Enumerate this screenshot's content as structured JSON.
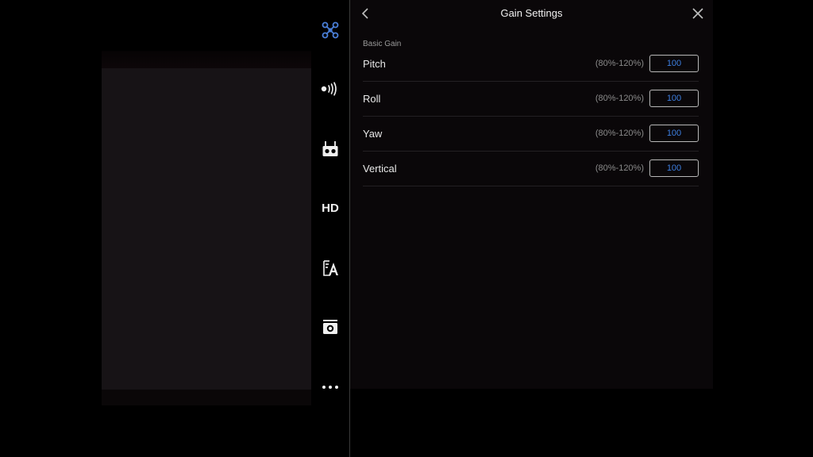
{
  "panel": {
    "title": "Gain Settings",
    "section_label": "Basic Gain",
    "rows": [
      {
        "label": "Pitch",
        "range": "(80%-120%)",
        "value": "100"
      },
      {
        "label": "Roll",
        "range": "(80%-120%)",
        "value": "100"
      },
      {
        "label": "Yaw",
        "range": "(80%-120%)",
        "value": "100"
      },
      {
        "label": "Vertical",
        "range": "(80%-120%)",
        "value": "100"
      }
    ]
  },
  "sidebar": {
    "items": [
      {
        "icon": "aircraft-icon",
        "color": "#4a7fd8"
      },
      {
        "icon": "signal-icon"
      },
      {
        "icon": "remote-controller-icon"
      },
      {
        "icon": "hd-icon",
        "label": "HD"
      },
      {
        "icon": "gimbal-tuning-icon"
      },
      {
        "icon": "camera-icon"
      },
      {
        "icon": "more-icon"
      }
    ]
  },
  "colors": {
    "accent": "#4a7fd8",
    "input_value": "#3d7fe0"
  }
}
